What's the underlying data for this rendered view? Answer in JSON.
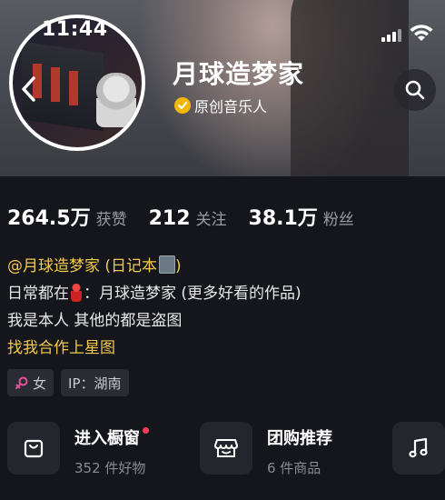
{
  "status_bar": {
    "time": "11:44"
  },
  "profile": {
    "username": "月球造梦家",
    "verification": "原创音乐人"
  },
  "stats": [
    {
      "value": "264.5万",
      "label": "获赞"
    },
    {
      "value": "212",
      "label": "关注"
    },
    {
      "value": "38.1万",
      "label": "粉丝"
    }
  ],
  "bio": {
    "mention": "@月球造梦家 (日记本",
    "mention_end": ")",
    "line2_prefix": "日常都在",
    "line2_suffix": "：月球造梦家 (更多好看的作品)",
    "line3": "我是本人 其他的都是盗图",
    "link": "找我合作上星图"
  },
  "tags": [
    {
      "icon": "female-icon",
      "label": "女"
    },
    {
      "label": "IP：湖南"
    }
  ],
  "cards": [
    {
      "icon": "shopping-bag-icon",
      "title": "进入橱窗",
      "subtitle": "352 件好物",
      "has_dot": true
    },
    {
      "icon": "store-icon",
      "title": "团购推荐",
      "subtitle": "6 件商品"
    },
    {
      "icon": "music-note-icon"
    }
  ],
  "colors": {
    "accent_yellow": "#f2c94c",
    "badge_gold": "#f2b705",
    "background": "#15161b",
    "female_pink": "#e0529c",
    "notification_red": "#ff3b5c"
  }
}
